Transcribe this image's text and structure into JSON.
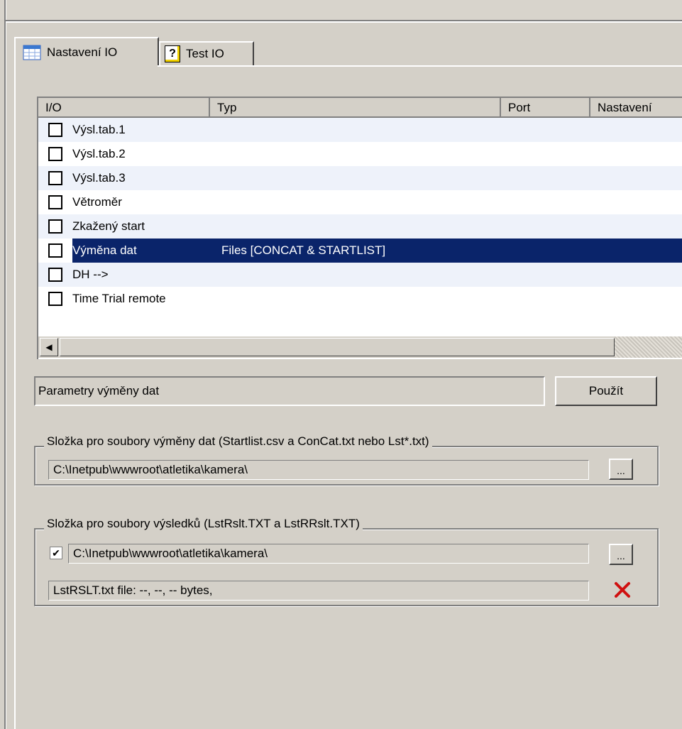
{
  "tabs": [
    {
      "label": "Nastavení IO",
      "icon": "table-icon",
      "active": true
    },
    {
      "label": "Test IO",
      "icon": "help-icon",
      "active": false
    }
  ],
  "listview": {
    "columns": [
      "I/O",
      "Typ",
      "Port",
      "Nastavení"
    ],
    "rows": [
      {
        "name": "Výsl.tab.1",
        "typ": "",
        "checked": false
      },
      {
        "name": "Výsl.tab.2",
        "typ": "",
        "checked": false
      },
      {
        "name": "Výsl.tab.3",
        "typ": "",
        "checked": false
      },
      {
        "name": "Větroměr",
        "typ": "",
        "checked": false
      },
      {
        "name": "Zkažený start",
        "typ": "",
        "checked": false
      },
      {
        "name": "Výměna dat",
        "typ": "Files [CONCAT & STARTLIST]",
        "checked": false,
        "selected": true
      },
      {
        "name": "DH -->",
        "typ": "",
        "checked": false
      },
      {
        "name": "Time Trial remote",
        "typ": "",
        "checked": false
      }
    ]
  },
  "params": {
    "title": "Parametry výměny dat",
    "apply_label": "Použít"
  },
  "group_exchange": {
    "legend": "Složka pro soubory výměny dat (Startlist.csv a ConCat.txt nebo Lst*.txt)",
    "path": "C:\\Inetpub\\wwwroot\\atletika\\kamera\\",
    "browse_label": "..."
  },
  "group_results": {
    "legend": "Složka pro soubory výsledků (LstRslt.TXT a LstRRslt.TXT)",
    "enabled": true,
    "path": "C:\\Inetpub\\wwwroot\\atletika\\kamera\\",
    "browse_label": "...",
    "file_info": "LstRSLT.txt file: --, --, -- bytes,",
    "delete_color": "#d01010"
  }
}
